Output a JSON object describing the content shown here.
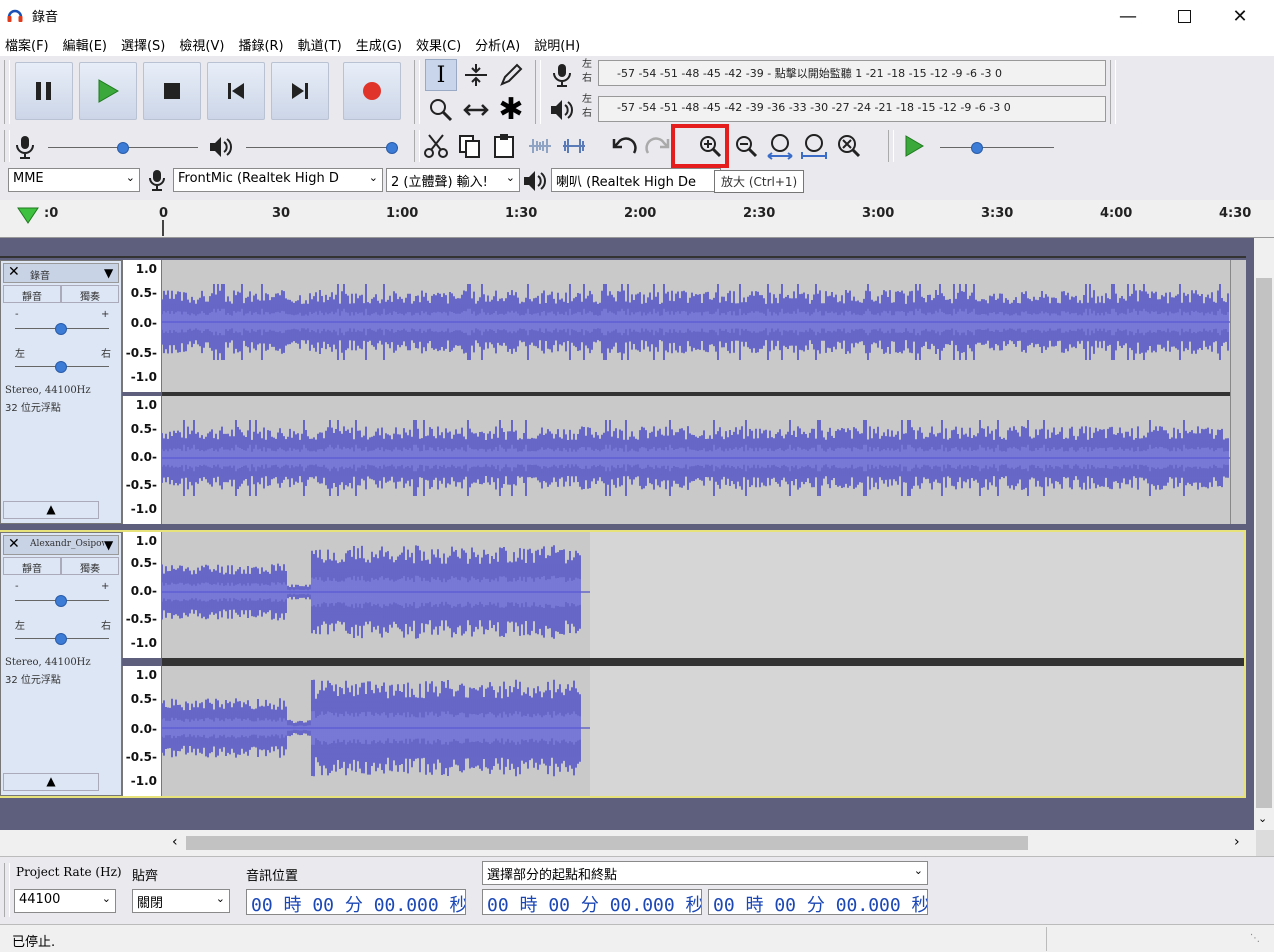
{
  "window": {
    "title": "錄音"
  },
  "menu": [
    "檔案(F)",
    "編輯(E)",
    "選擇(S)",
    "檢視(V)",
    "播錄(R)",
    "軌道(T)",
    "生成(G)",
    "效果(C)",
    "分析(A)",
    "說明(H)"
  ],
  "meters": {
    "record_channel_top": "左",
    "record_channel_bottom": "右",
    "record_ticks": "-57 -54 -51 -48 -45 -42 -39 - 點擊以開始監聽 1 -21 -18 -15 -12 -9 -6 -3 0",
    "play_channel_top": "左",
    "play_channel_bottom": "右",
    "play_ticks": "-57 -54 -51 -48 -45 -42 -39 -36 -33 -30 -27 -24 -21 -18 -15 -12 -9 -6 -3 0"
  },
  "sliders": {
    "mic_level": 0.5,
    "speaker_level": 1.0,
    "play_speed": 0.3
  },
  "device": {
    "host": "MME",
    "input": "FrontMic (Realtek High D",
    "channels": "2 (立體聲) 輸入!",
    "output": "喇叭 (Realtek High De"
  },
  "tooltip": "放大 (Ctrl+1)",
  "ruler": {
    "ticks": [
      ":0",
      "0",
      "30",
      "1:00",
      "1:30",
      "2:00",
      "2:30",
      "3:00",
      "3:30",
      "4:00",
      "4:30"
    ]
  },
  "tracks": [
    {
      "name": "錄音",
      "mute": "靜音",
      "solo": "獨奏",
      "vol_minus": "-",
      "vol_plus": "+",
      "pan_left": "左",
      "pan_right": "右",
      "info_line1": "Stereo, 44100Hz",
      "info_line2": "32 位元浮點",
      "scale": [
        "1.0",
        "0.5-",
        "0.0-",
        "-0.5-",
        "-1.0"
      ]
    },
    {
      "name": "Alexandr_Osipov",
      "mute": "靜音",
      "solo": "獨奏",
      "vol_minus": "-",
      "vol_plus": "+",
      "pan_left": "左",
      "pan_right": "右",
      "info_line1": "Stereo, 44100Hz",
      "info_line2": "32 位元浮點",
      "scale": [
        "1.0",
        "0.5-",
        "0.0-",
        "-0.5-",
        "-1.0"
      ]
    }
  ],
  "selection_bar": {
    "rate_label": "Project Rate (Hz)",
    "rate_value": "44100",
    "snap_label": "貼齊",
    "snap_value": "關閉",
    "audio_pos_label": "音訊位置",
    "audio_pos_value": "00 時 00 分 00.000 秒",
    "sel_mode": "選擇部分的起點和終點",
    "sel_start": "00 時 00 分 00.000 秒",
    "sel_end": "00 時 00 分 00.000 秒"
  },
  "status": "已停止."
}
